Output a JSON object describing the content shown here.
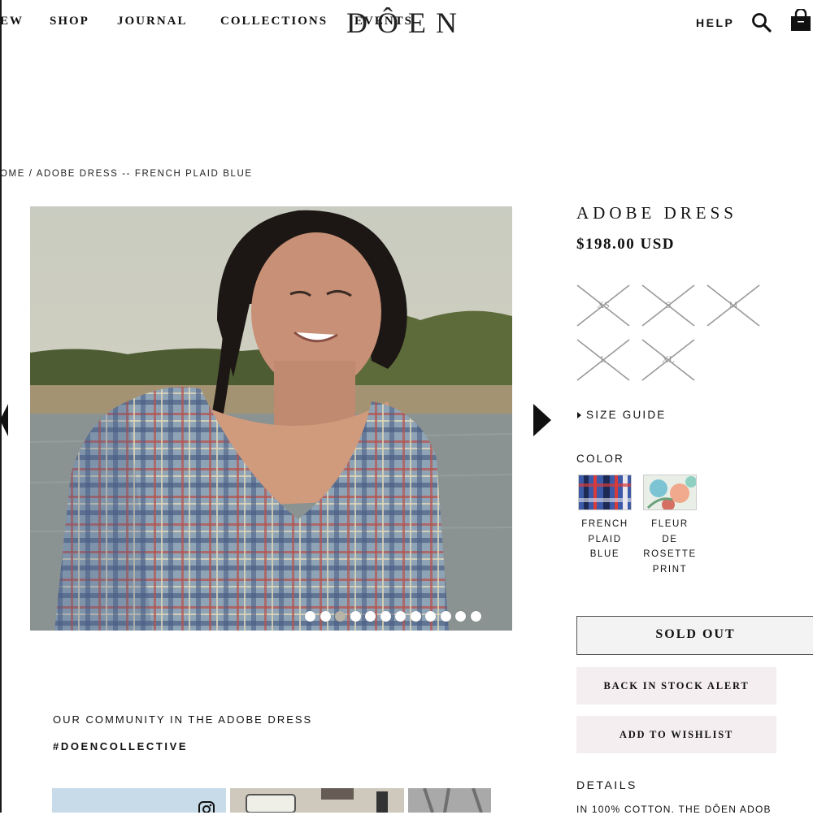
{
  "header": {
    "nav": [
      "EW",
      "SHOP",
      "JOURNAL",
      "COLLECTIONS",
      "EVENTS"
    ],
    "logo": "DÔEN",
    "help": "HELP",
    "icons": [
      "search-icon",
      "shopping-bag-icon"
    ]
  },
  "breadcrumb": "OME / ADOBE DRESS -- FRENCH PLAID BLUE",
  "gallery": {
    "slide_count": 12,
    "active_index": 2,
    "icons": [
      "previous-arrow-icon",
      "next-arrow-icon"
    ]
  },
  "product": {
    "title": "ADOBE DRESS",
    "price": "$198.00 USD",
    "sizes": [
      {
        "label": "XS",
        "available": false
      },
      {
        "label": "S",
        "available": false
      },
      {
        "label": "M",
        "available": false
      },
      {
        "label": "L",
        "available": false
      },
      {
        "label": "XL",
        "available": false
      }
    ],
    "size_guide": "SIZE GUIDE",
    "color_heading": "COLOR",
    "colors": [
      {
        "label": "FRENCH PLAID BLUE",
        "lines": [
          "FRENCH",
          "PLAID",
          "BLUE"
        ]
      },
      {
        "label": "FLEUR DE ROSETTE PRINT",
        "lines": [
          "FLEUR",
          "DE",
          "ROSETTE",
          "PRINT"
        ]
      }
    ],
    "sold_out": "SOLD OUT",
    "back_in_stock": "BACK IN STOCK ALERT",
    "wishlist": "ADD TO WISHLIST",
    "details_heading": "DETAILS",
    "details_text": "IN 100% COTTON. THE DÔEN ADOB"
  },
  "community": {
    "heading": "OUR COMMUNITY IN THE ADOBE DRESS",
    "hashtag": "#DOENCOLLECTIVE",
    "icons": [
      "instagram-icon"
    ]
  },
  "colors": {
    "text": "#111111",
    "pink_button": "#f5eef0",
    "sold_out_bg": "#f3f3f3"
  }
}
